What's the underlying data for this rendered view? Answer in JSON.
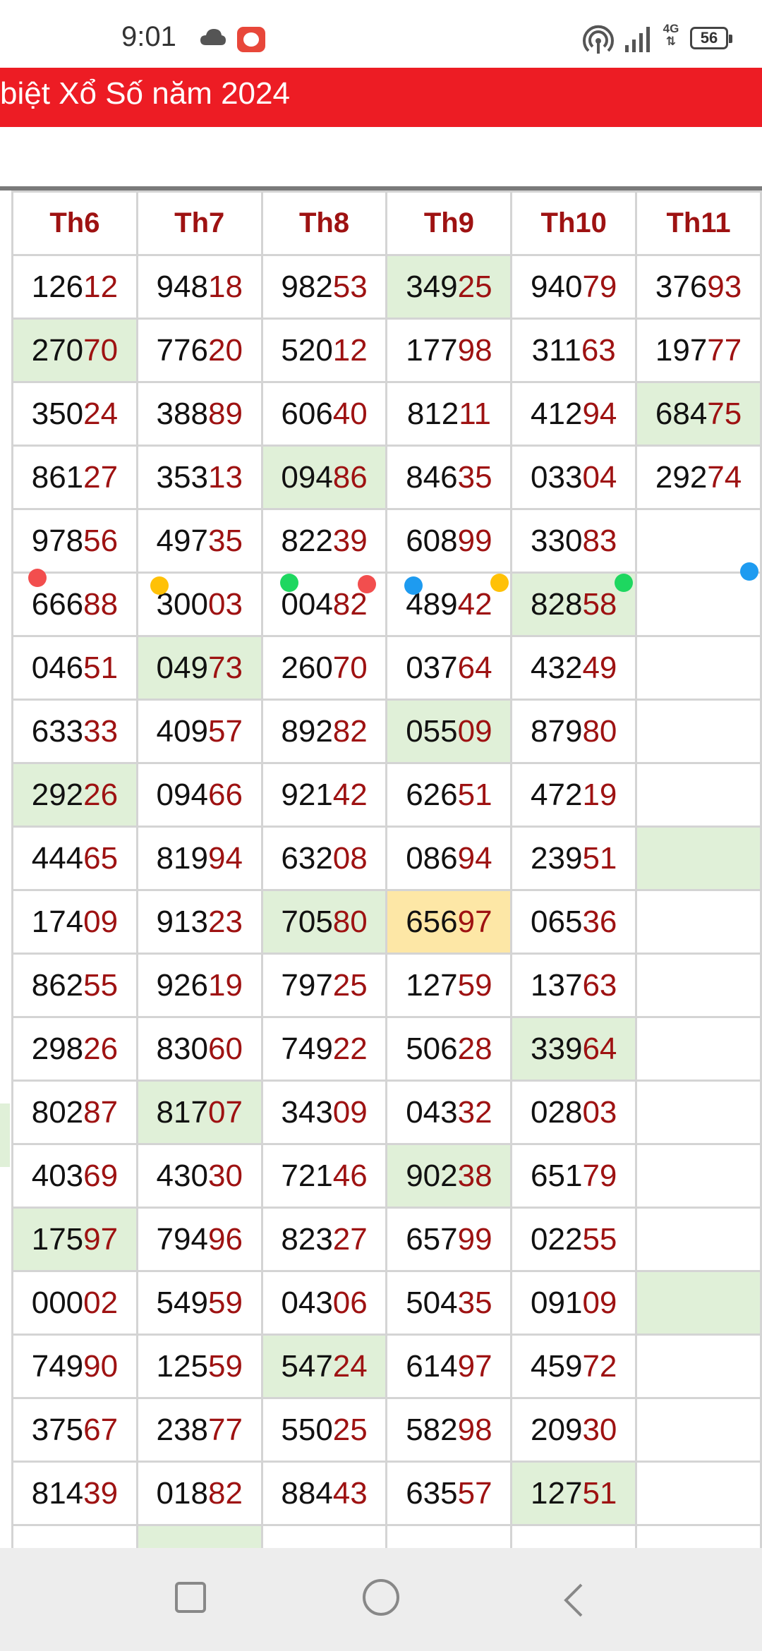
{
  "status_bar": {
    "time": "9:01",
    "network_type": "4G",
    "battery": "56"
  },
  "banner": {
    "title": "biệt Xổ Số năm 2024"
  },
  "table": {
    "headers": [
      "Th6",
      "Th7",
      "Th8",
      "Th9",
      "Th10",
      "Th11"
    ],
    "rows": [
      [
        [
          "126",
          "12"
        ],
        [
          "948",
          "18"
        ],
        [
          "982",
          "53"
        ],
        [
          "349",
          "25"
        ],
        [
          "940",
          "79"
        ],
        [
          "376",
          "93"
        ]
      ],
      [
        [
          "270",
          "70"
        ],
        [
          "776",
          "20"
        ],
        [
          "520",
          "12"
        ],
        [
          "177",
          "98"
        ],
        [
          "311",
          "63"
        ],
        [
          "197",
          "77"
        ]
      ],
      [
        [
          "350",
          "24"
        ],
        [
          "388",
          "89"
        ],
        [
          "606",
          "40"
        ],
        [
          "812",
          "11"
        ],
        [
          "412",
          "94"
        ],
        [
          "684",
          "75"
        ]
      ],
      [
        [
          "861",
          "27"
        ],
        [
          "353",
          "13"
        ],
        [
          "094",
          "86"
        ],
        [
          "846",
          "35"
        ],
        [
          "033",
          "04"
        ],
        [
          "292",
          "74"
        ]
      ],
      [
        [
          "978",
          "56"
        ],
        [
          "497",
          "35"
        ],
        [
          "822",
          "39"
        ],
        [
          "608",
          "99"
        ],
        [
          "330",
          "83"
        ],
        [
          "",
          ""
        ]
      ],
      [
        [
          "666",
          "88"
        ],
        [
          "300",
          "03"
        ],
        [
          "004",
          "82"
        ],
        [
          "489",
          "42"
        ],
        [
          "828",
          "58"
        ],
        [
          "",
          ""
        ]
      ],
      [
        [
          "046",
          "51"
        ],
        [
          "049",
          "73"
        ],
        [
          "260",
          "70"
        ],
        [
          "037",
          "64"
        ],
        [
          "432",
          "49"
        ],
        [
          "",
          ""
        ]
      ],
      [
        [
          "633",
          "33"
        ],
        [
          "409",
          "57"
        ],
        [
          "892",
          "82"
        ],
        [
          "055",
          "09"
        ],
        [
          "879",
          "80"
        ],
        [
          "",
          ""
        ]
      ],
      [
        [
          "292",
          "26"
        ],
        [
          "094",
          "66"
        ],
        [
          "921",
          "42"
        ],
        [
          "626",
          "51"
        ],
        [
          "472",
          "19"
        ],
        [
          "",
          ""
        ]
      ],
      [
        [
          "444",
          "65"
        ],
        [
          "819",
          "94"
        ],
        [
          "632",
          "08"
        ],
        [
          "086",
          "94"
        ],
        [
          "239",
          "51"
        ],
        [
          "",
          ""
        ]
      ],
      [
        [
          "174",
          "09"
        ],
        [
          "913",
          "23"
        ],
        [
          "705",
          "80"
        ],
        [
          "656",
          "97"
        ],
        [
          "065",
          "36"
        ],
        [
          "",
          ""
        ]
      ],
      [
        [
          "862",
          "55"
        ],
        [
          "926",
          "19"
        ],
        [
          "797",
          "25"
        ],
        [
          "127",
          "59"
        ],
        [
          "137",
          "63"
        ],
        [
          "",
          ""
        ]
      ],
      [
        [
          "298",
          "26"
        ],
        [
          "830",
          "60"
        ],
        [
          "749",
          "22"
        ],
        [
          "506",
          "28"
        ],
        [
          "339",
          "64"
        ],
        [
          "",
          ""
        ]
      ],
      [
        [
          "802",
          "87"
        ],
        [
          "817",
          "07"
        ],
        [
          "343",
          "09"
        ],
        [
          "043",
          "32"
        ],
        [
          "028",
          "03"
        ],
        [
          "",
          ""
        ]
      ],
      [
        [
          "403",
          "69"
        ],
        [
          "430",
          "30"
        ],
        [
          "721",
          "46"
        ],
        [
          "902",
          "38"
        ],
        [
          "651",
          "79"
        ],
        [
          "",
          ""
        ]
      ],
      [
        [
          "175",
          "97"
        ],
        [
          "794",
          "96"
        ],
        [
          "823",
          "27"
        ],
        [
          "657",
          "99"
        ],
        [
          "022",
          "55"
        ],
        [
          "",
          ""
        ]
      ],
      [
        [
          "000",
          "02"
        ],
        [
          "549",
          "59"
        ],
        [
          "043",
          "06"
        ],
        [
          "504",
          "35"
        ],
        [
          "091",
          "09"
        ],
        [
          "",
          ""
        ]
      ],
      [
        [
          "749",
          "90"
        ],
        [
          "125",
          "59"
        ],
        [
          "547",
          "24"
        ],
        [
          "614",
          "97"
        ],
        [
          "459",
          "72"
        ],
        [
          "",
          ""
        ]
      ],
      [
        [
          "375",
          "67"
        ],
        [
          "238",
          "77"
        ],
        [
          "550",
          "25"
        ],
        [
          "582",
          "98"
        ],
        [
          "209",
          "30"
        ],
        [
          "",
          ""
        ]
      ],
      [
        [
          "814",
          "39"
        ],
        [
          "018",
          "82"
        ],
        [
          "884",
          "43"
        ],
        [
          "635",
          "57"
        ],
        [
          "127",
          "51"
        ],
        [
          "",
          ""
        ]
      ],
      [
        [
          "",
          ""
        ],
        [
          "",
          ""
        ],
        [
          "",
          ""
        ],
        [
          "",
          ""
        ],
        [
          "",
          ""
        ],
        [
          "",
          ""
        ]
      ]
    ],
    "highlight_green": [
      [
        0,
        3
      ],
      [
        1,
        0
      ],
      [
        2,
        5
      ],
      [
        3,
        2
      ],
      [
        5,
        4
      ],
      [
        6,
        1
      ],
      [
        7,
        3
      ],
      [
        8,
        0
      ],
      [
        9,
        5
      ],
      [
        10,
        2
      ],
      [
        12,
        4
      ],
      [
        13,
        1
      ],
      [
        14,
        3
      ],
      [
        15,
        0
      ],
      [
        16,
        5
      ],
      [
        17,
        2
      ],
      [
        19,
        4
      ],
      [
        20,
        1
      ]
    ],
    "highlight_yellow": [
      [
        10,
        3
      ]
    ]
  },
  "colors": {
    "banner": "#ed1c24",
    "header_text": "#9e1212",
    "suffix_text": "#9e1212",
    "highlight_green": "#e0f0d8",
    "highlight_yellow": "#fde7a6",
    "dot_colors": [
      "#f24e4e",
      "#ffc107",
      "#1ed760",
      "#f24e4e",
      "#1e9bf0",
      "#ffc107",
      "#1ed760",
      "#1e9bf0"
    ]
  }
}
